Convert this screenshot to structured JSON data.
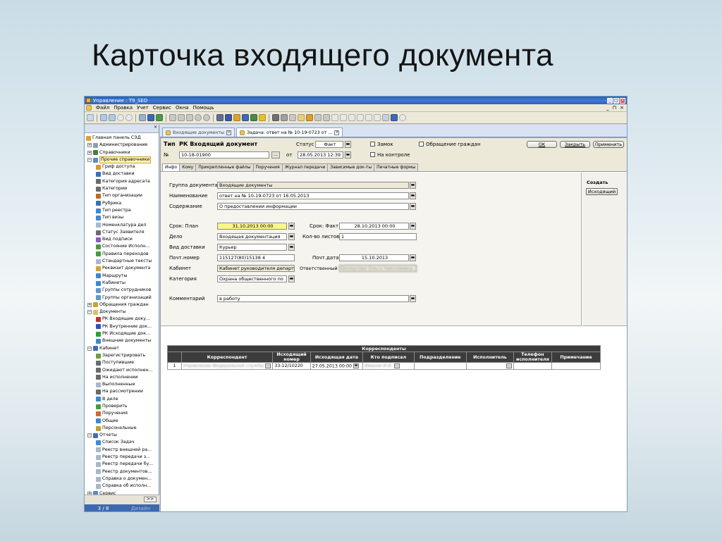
{
  "slide": {
    "title": "Карточка входящего документа"
  },
  "window": {
    "title": "Управление : T9_SED"
  },
  "menubar": {
    "items": [
      "Файл",
      "Правка",
      "Учет",
      "Сервис",
      "Окна",
      "Помощь"
    ],
    "right": [
      "_",
      "⊓",
      "×"
    ]
  },
  "left_panel": {
    "close_glyph": "×",
    "tree": [
      {
        "label": "Главная панель СЭД",
        "pm": "",
        "color": "#e0a030",
        "indent": 0
      },
      {
        "label": "Администрирование",
        "pm": "+",
        "color": "#8f9fb0",
        "indent": 1
      },
      {
        "label": "Справочники",
        "pm": "+",
        "color": "#4a7f3a",
        "indent": 1
      },
      {
        "label": "Прочие справочники",
        "pm": "−",
        "color": "#5a8ad0",
        "indent": 1,
        "selected": true
      },
      {
        "label": "Гриф доступа",
        "pm": "",
        "color": "#d89a28",
        "indent": 2
      },
      {
        "label": "Вид доставки",
        "pm": "",
        "color": "#3b6fb8",
        "indent": 2
      },
      {
        "label": "Категория адресата",
        "pm": "",
        "color": "#6a6a6a",
        "indent": 2
      },
      {
        "label": "Категории",
        "pm": "",
        "color": "#6a6a6a",
        "indent": 2
      },
      {
        "label": "Тип организации",
        "pm": "",
        "color": "#c06a20",
        "indent": 2
      },
      {
        "label": "Рубрика",
        "pm": "",
        "color": "#3b6fb8",
        "indent": 2
      },
      {
        "label": "Тип реестра",
        "pm": "",
        "color": "#3b8ad0",
        "indent": 2
      },
      {
        "label": "Тип визы",
        "pm": "",
        "color": "#3b8ad0",
        "indent": 2
      },
      {
        "label": "Номенклатура дел",
        "pm": "",
        "color": "#a8b8d0",
        "indent": 2
      },
      {
        "label": "Статус Заявителя",
        "pm": "",
        "color": "#6a6a6a",
        "indent": 2
      },
      {
        "label": "Вид подписи",
        "pm": "",
        "color": "#8a5ac0",
        "indent": 2
      },
      {
        "label": "Состояние Исполн...",
        "pm": "",
        "color": "#4a9a3a",
        "indent": 2
      },
      {
        "label": "Правила переходов",
        "pm": "",
        "color": "#4a9a3a",
        "indent": 2
      },
      {
        "label": "Стандартные тексты",
        "pm": "",
        "color": "#a8b8d0",
        "indent": 2
      },
      {
        "label": "Реквизит документа",
        "pm": "",
        "color": "#d8a030",
        "indent": 2
      },
      {
        "label": "Маршруты",
        "pm": "",
        "color": "#3b8ad0",
        "indent": 2
      },
      {
        "label": "Кабинеты",
        "pm": "",
        "color": "#3b8ad0",
        "indent": 2
      },
      {
        "label": "Группы сотрудников",
        "pm": "",
        "color": "#5a9ad0",
        "indent": 2
      },
      {
        "label": "Группы организаций",
        "pm": "",
        "color": "#5a9ad0",
        "indent": 2
      },
      {
        "label": "Обращения граждан",
        "pm": "+",
        "color": "#d0a030",
        "indent": 1
      },
      {
        "label": "Документы",
        "pm": "−",
        "color": "#e0c060",
        "indent": 1
      },
      {
        "label": "РК Входящие доку...",
        "pm": "",
        "color": "#c03030",
        "indent": 2
      },
      {
        "label": "РК Внутренние док...",
        "pm": "",
        "color": "#3050c0",
        "indent": 2
      },
      {
        "label": "РК Исходящие док...",
        "pm": "",
        "color": "#30a030",
        "indent": 2
      },
      {
        "label": "Внешние документы",
        "pm": "",
        "color": "#3b8ad0",
        "indent": 2
      },
      {
        "label": "Кабинет",
        "pm": "−",
        "color": "#3b6fb8",
        "indent": 1
      },
      {
        "label": "Зарегистрировать",
        "pm": "",
        "color": "#6aa040",
        "indent": 2
      },
      {
        "label": "Поступившие",
        "pm": "",
        "color": "#6a6a6a",
        "indent": 2
      },
      {
        "label": "Ожидают исполнен...",
        "pm": "",
        "color": "#6a6a6a",
        "indent": 2
      },
      {
        "label": "На исполнении",
        "pm": "",
        "color": "#6a6a6a",
        "indent": 2
      },
      {
        "label": "Выполненные",
        "pm": "",
        "color": "#a8b8d0",
        "indent": 2
      },
      {
        "label": "На рассмотрении",
        "pm": "",
        "color": "#6a6a6a",
        "indent": 2
      },
      {
        "label": "В деле",
        "pm": "",
        "color": "#3b8ad0",
        "indent": 2
      },
      {
        "label": "Проверить",
        "pm": "",
        "color": "#4a9a3a",
        "indent": 2
      },
      {
        "label": "Поручения",
        "pm": "",
        "color": "#d06a30",
        "indent": 2
      },
      {
        "label": "Общие",
        "pm": "",
        "color": "#3b8ad0",
        "indent": 2
      },
      {
        "label": "Персональные",
        "pm": "",
        "color": "#c0a030",
        "indent": 2
      },
      {
        "label": "Отчеты",
        "pm": "−",
        "color": "#3b6fb8",
        "indent": 1
      },
      {
        "label": "Список Задач",
        "pm": "",
        "color": "#3b8ad0",
        "indent": 2
      },
      {
        "label": "Реестр внешней ра...",
        "pm": "",
        "color": "#a8b8c8",
        "indent": 2
      },
      {
        "label": "Реестр передачи з...",
        "pm": "",
        "color": "#a8b8c8",
        "indent": 2
      },
      {
        "label": "Реестр передачи бу...",
        "pm": "",
        "color": "#a8b8c8",
        "indent": 2
      },
      {
        "label": "Реестр документов...",
        "pm": "",
        "color": "#a8b8c8",
        "indent": 2
      },
      {
        "label": "Справка о докумен...",
        "pm": "",
        "color": "#a8b8c8",
        "indent": 2
      },
      {
        "label": "Справка об исполн...",
        "pm": "",
        "color": "#a8b8c8",
        "indent": 2
      },
      {
        "label": "Сервис",
        "pm": "+",
        "color": "#5a8ad0",
        "indent": 1
      }
    ],
    "nav_button": ">>",
    "page": "3 / 8",
    "page_right": "Дизайн"
  },
  "doc_tabs": [
    {
      "label": "Входящие документы",
      "active": false
    },
    {
      "label": "Задача: ответ на № 10-19-0723 от ...",
      "active": true
    }
  ],
  "header": {
    "type_label": "Тип",
    "type_value": "РК Входящий документ",
    "num_label": "№",
    "num_value": "10-18-01900",
    "from_label": "от",
    "date_value": "28.05.2013 12:39",
    "status_label": "Статус",
    "status_value": "Факт",
    "lock_label": "Замок",
    "control_label": "На контроле",
    "citizens_label": "Обращение граждан",
    "ok": "OK",
    "close": "Закрыть",
    "apply": "Применить",
    "ellipsis": "..."
  },
  "sub_tabs": [
    "Инфо",
    "Кому",
    "Прикрепленные файлы",
    "Поручения",
    "Журнал передачи",
    "Зависимые док-ты",
    "Печатные формы"
  ],
  "form": {
    "group_label": "Группа документа",
    "group_value": "Входящие документы",
    "name_label": "Наименование",
    "name_value": "ответ на № 10-19-0723 от 16.05.2013",
    "content_label": "Содержание",
    "content_value": "О предоставлении информации",
    "plan_label": "Срок: План",
    "plan_value": "31.10.2013 00:00",
    "fact_label": "Срок: Факт",
    "fact_value": "28.10.2013 00:00",
    "case_label": "Дело",
    "case_value": "Входящая документация",
    "sheets_label": "Кол-во листов",
    "sheets_value": "1",
    "delivery_label": "Вид доставки",
    "delivery_value": "Курьер",
    "post_label": "Почт.номер",
    "post_value": "115127(80)15138 4",
    "postdate_label": "Почт.дата",
    "postdate_value": "15.10.2013",
    "cabinet_label": "Кабинет",
    "cabinet_value": "Кабинет руководителя департ",
    "resp_label": "Ответственный",
    "resp_value": "Белоусова Ольга Николаевна",
    "category_label": "Категория",
    "category_value": "Охрана общественного по",
    "comment_label": "Комментарий",
    "comment_value": "в работу"
  },
  "side": {
    "create_label": "Создать",
    "incoming_button": "Исходящий"
  },
  "grid": {
    "title": "Корреспонденты",
    "headers": [
      "",
      "Корреспондент",
      "Исходящий номер",
      "Исходящая дата",
      "Кто подписал",
      "Подразделение",
      "Исполнитель",
      "Телефон исполнителя",
      "Примечание"
    ],
    "row": {
      "n": "1",
      "corr": "Управление Федеральной службы",
      "num": "33-12/10220",
      "date": "27.05.2013 00:00",
      "signer": "Иванов И.И.",
      "dept": "",
      "exec": "",
      "phone": "",
      "note": ""
    }
  }
}
